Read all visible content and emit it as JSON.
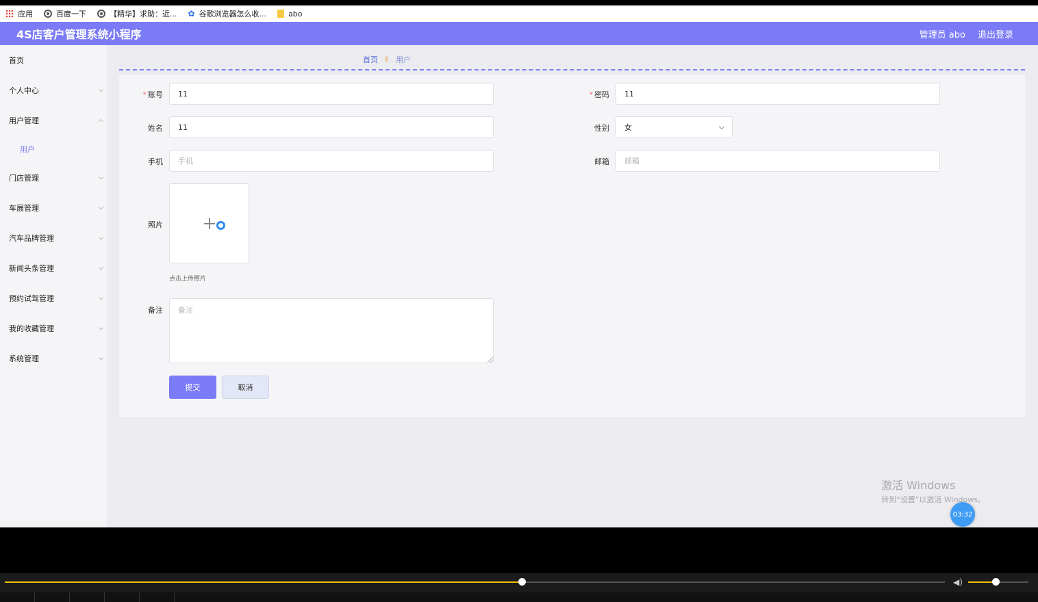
{
  "browser": {
    "bookmarks": [
      {
        "label": "应用",
        "icon": "apps-icon"
      },
      {
        "label": "百度一下",
        "icon": "globe-icon"
      },
      {
        "label": "【精华】求助：近...",
        "icon": "globe-icon"
      },
      {
        "label": "谷歌浏览器怎么收...",
        "icon": "paw-icon"
      },
      {
        "label": "abo",
        "icon": "folder-icon"
      }
    ]
  },
  "header": {
    "title": "4S店客户管理系统小程序",
    "user_label": "管理员 abo",
    "logout_label": "退出登录",
    "color": "#7b7bf7"
  },
  "sidebar": {
    "home": "首页",
    "personal": "个人中心",
    "user_mgmt": "用户管理",
    "user_sub": "用户",
    "store_mgmt": "门店管理",
    "show_mgmt": "车展管理",
    "brand_mgmt": "汽车品牌管理",
    "news_mgmt": "新闻头条管理",
    "testdrive_mgmt": "预约试驾管理",
    "favorites_mgmt": "我的收藏管理",
    "system_mgmt": "系统管理"
  },
  "breadcrumb": {
    "home": "首页",
    "current": "用户"
  },
  "form": {
    "account": {
      "label": "账号",
      "value": "11",
      "required": true
    },
    "password": {
      "label": "密码",
      "value": "11",
      "required": true
    },
    "name": {
      "label": "姓名",
      "value": "11"
    },
    "gender": {
      "label": "性别",
      "value": "女"
    },
    "phone": {
      "label": "手机",
      "value": "",
      "placeholder": "手机"
    },
    "email": {
      "label": "邮箱",
      "value": "",
      "placeholder": "邮箱"
    },
    "photo": {
      "label": "照片",
      "hint": "点击上传照片"
    },
    "remark": {
      "label": "备注",
      "value": "",
      "placeholder": "备注"
    },
    "submit_label": "提交",
    "cancel_label": "取消"
  },
  "overlay": {
    "watermark_title": "激活 Windows",
    "watermark_sub": "转到“设置”以激活 Windows。",
    "timer": "03:32"
  },
  "player": {
    "progress": 0.55,
    "volume": 0.45,
    "accent": "#f2c200"
  }
}
